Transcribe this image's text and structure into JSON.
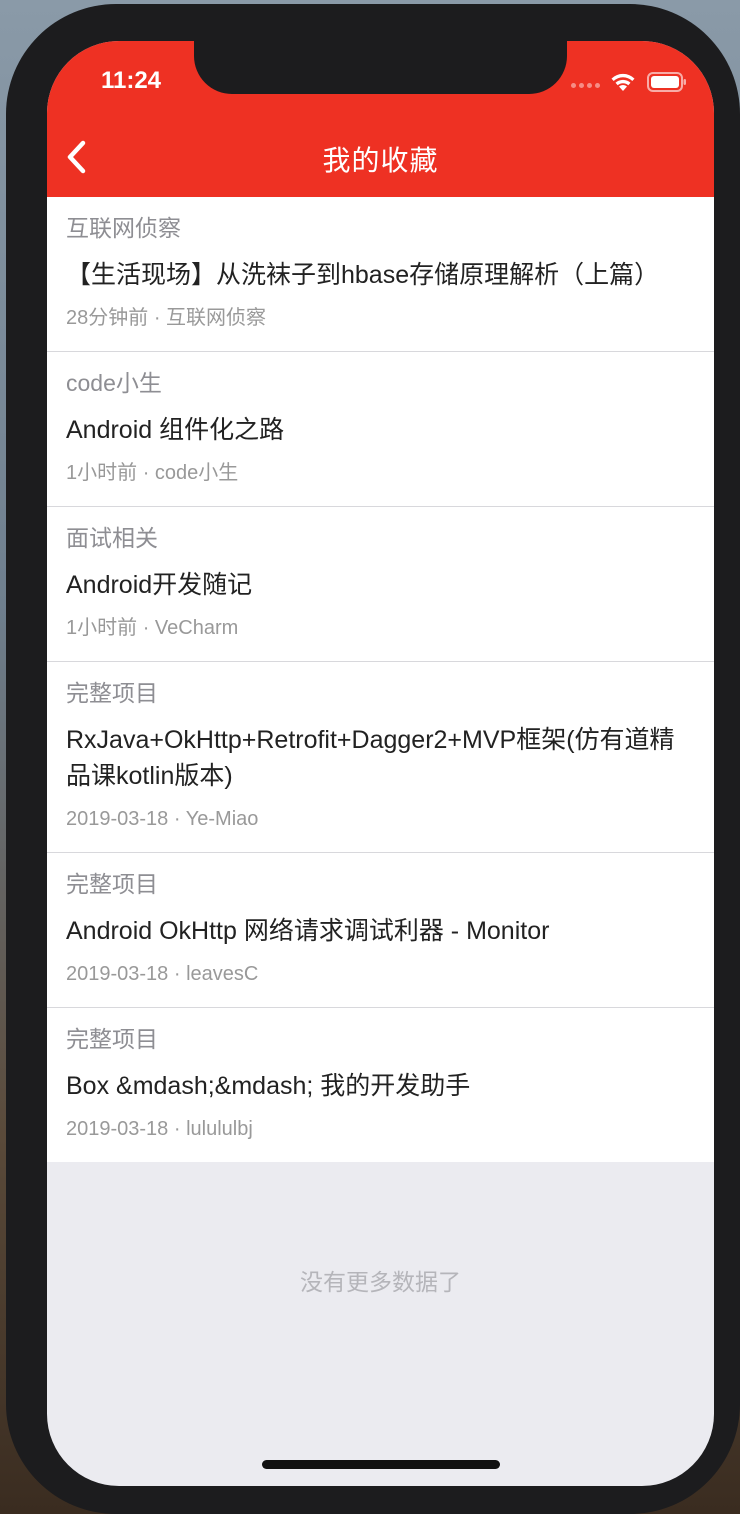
{
  "status_bar": {
    "time": "11:24"
  },
  "header": {
    "title": "我的收藏"
  },
  "items": [
    {
      "category": "互联网侦察",
      "title": "【生活现场】从洗袜子到hbase存储原理解析（上篇）",
      "time": "28分钟前",
      "author": "互联网侦察"
    },
    {
      "category": "code小生",
      "title": "Android 组件化之路",
      "time": "1小时前",
      "author": "code小生"
    },
    {
      "category": "面试相关",
      "title": "Android开发随记",
      "time": "1小时前",
      "author": "VeCharm"
    },
    {
      "category": "完整项目",
      "title": "RxJava+OkHttp+Retrofit+Dagger2+MVP框架(仿有道精品课kotlin版本)",
      "time": "2019-03-18",
      "author": "Ye-Miao"
    },
    {
      "category": "完整项目",
      "title": "Android OkHttp 网络请求调试利器 - Monitor",
      "time": "2019-03-18",
      "author": "leavesC"
    },
    {
      "category": "完整项目",
      "title": "Box &mdash;&mdash; 我的开发助手",
      "time": "2019-03-18",
      "author": "lulululbj"
    }
  ],
  "meta_separator": "·",
  "footer": {
    "no_more": "没有更多数据了"
  },
  "colors": {
    "accent": "#ee3123",
    "background": "#ebebf0"
  },
  "icons": {
    "back": "chevron-left-icon",
    "wifi": "wifi-icon",
    "battery": "battery-icon"
  }
}
